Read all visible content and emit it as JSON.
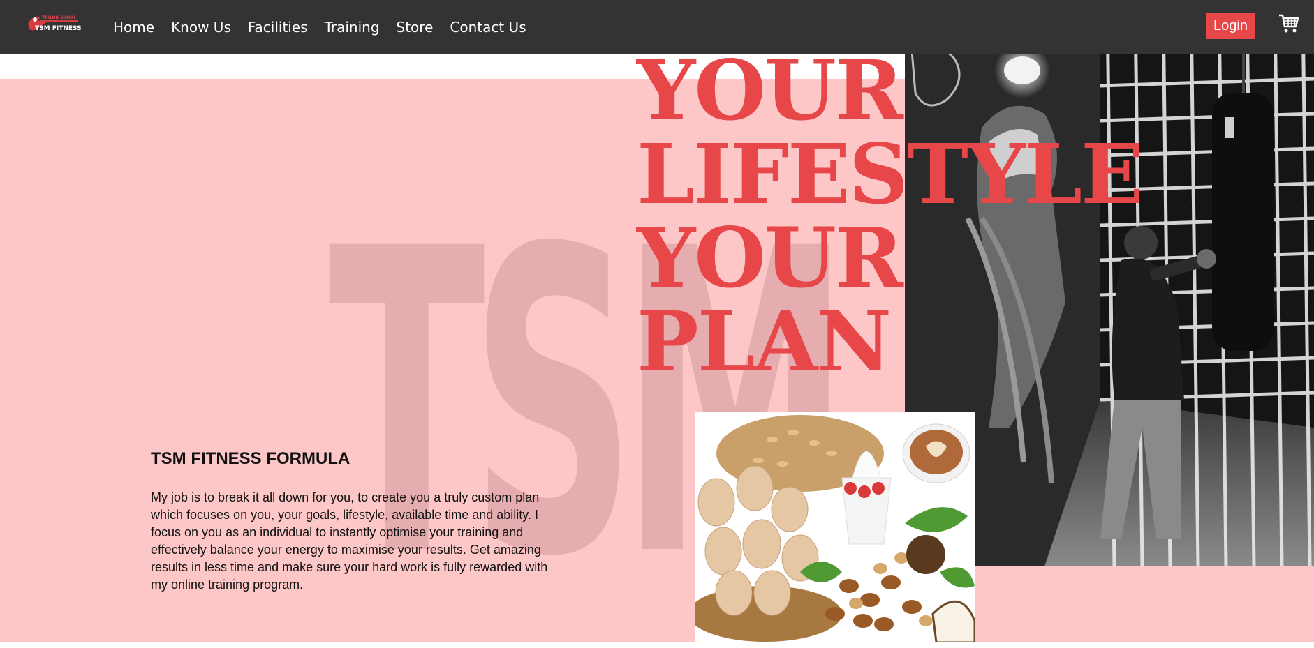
{
  "header": {
    "logo_text_top": "TRILOK SINGH",
    "logo_text_bottom": "TSM FITNESS",
    "nav": [
      {
        "label": "Home"
      },
      {
        "label": "Know Us"
      },
      {
        "label": "Facilities"
      },
      {
        "label": "Training"
      },
      {
        "label": "Store"
      },
      {
        "label": "Contact Us"
      }
    ],
    "login_label": "Login"
  },
  "hero": {
    "headline_lines": [
      "YOUR",
      "LIFESTYLE",
      "YOUR",
      "PLAN"
    ],
    "watermark": "TSM"
  },
  "formula": {
    "title": "TSM FITNESS FORMULA",
    "text": "My job is to break it all down for you, to create you a truly custom plan which focuses on you, your goals, lifestyle, available time and ability. I focus on you as an individual to instantly optimise your training and effectively balance your energy to maximise your results. Get amazing results in less time and make sure your hard work is fully rewarded with my online training program."
  },
  "colors": {
    "nav_bg": "#333333",
    "accent": "#e8474a",
    "pink_bg": "#fec7c7"
  }
}
